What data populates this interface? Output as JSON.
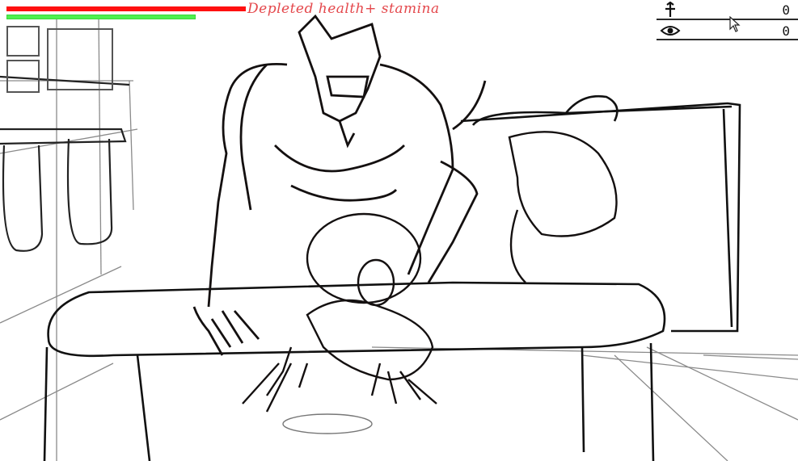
{
  "hud": {
    "health": {
      "label": "health",
      "fraction": 0.0,
      "color": "#ff1010"
    },
    "stamina": {
      "label": "stamina",
      "fraction": 0.0,
      "color": "#4ff04f"
    },
    "status_note": "Depleted health+ stamina",
    "status_color": "#e4484c"
  },
  "inventory_slots": [
    {
      "id": "slot-1",
      "icon": "empty-slot"
    },
    {
      "id": "slot-2",
      "icon": "empty-slot"
    },
    {
      "id": "slot-3",
      "icon": "empty-slot"
    }
  ],
  "counters": [
    {
      "icon": "sword-icon",
      "value": "0"
    },
    {
      "icon": "eye-icon",
      "value": "0"
    }
  ],
  "scene": {
    "description_icon": "sketch-scene",
    "line_color": "#1a1212"
  }
}
